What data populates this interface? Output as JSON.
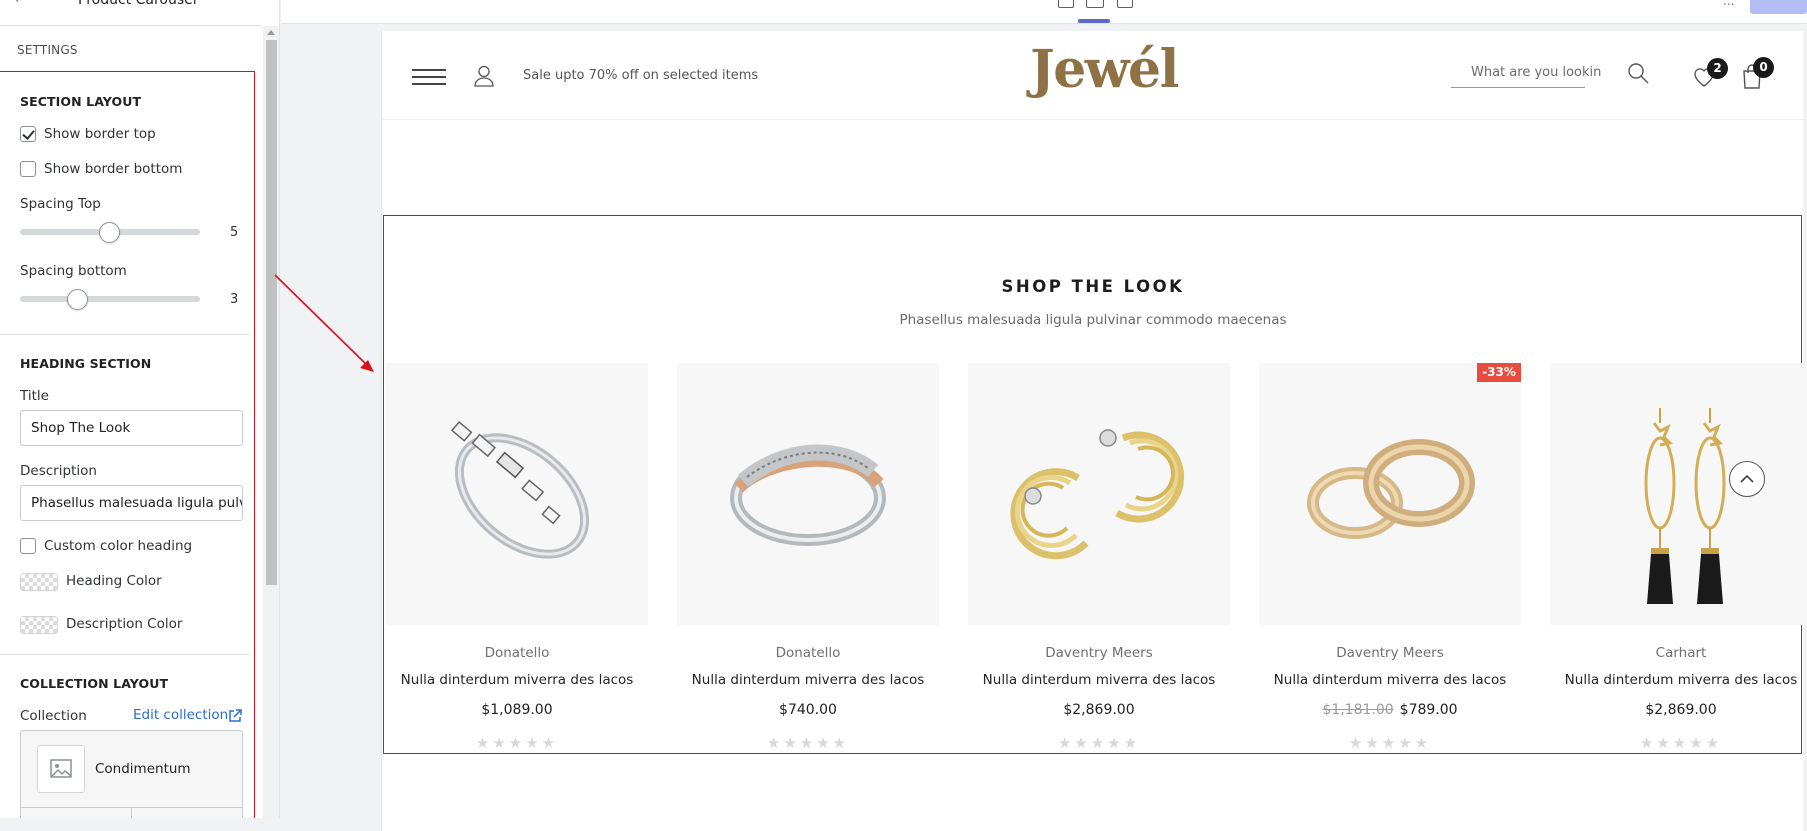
{
  "sidebar": {
    "back_icon": "arrow-left-icon",
    "page_title": "Product Carousel",
    "settings_label": "SETTINGS",
    "section_layout": {
      "title": "SECTION LAYOUT",
      "show_border_top": "Show border top",
      "show_border_bottom": "Show border bottom",
      "spacing_top_label": "Spacing Top",
      "spacing_top_value": "5",
      "spacing_bottom_label": "Spacing bottom",
      "spacing_bottom_value": "3"
    },
    "heading_section": {
      "title": "HEADING SECTION",
      "title_label": "Title",
      "title_value": "Shop The Look",
      "description_label": "Description",
      "description_value": "Phasellus malesuada ligula pulvir",
      "custom_color_label": "Custom color heading",
      "heading_color_label": "Heading Color",
      "description_color_label": "Description Color"
    },
    "collection_layout": {
      "title": "COLLECTION LAYOUT",
      "collection_label": "Collection",
      "edit_link": "Edit collection",
      "collection_name": "Condimentum"
    }
  },
  "topbar": {
    "right_text": "...",
    "accent": "#5c6ac4"
  },
  "store": {
    "promo": "Sale upto 70% off on selected items",
    "logo": "Jewél",
    "search_placeholder": "What are you lookin",
    "wishlist_count": "2",
    "cart_count": "0",
    "section": {
      "title": "SHOP THE LOOK",
      "subtitle": "Phasellus malesuada ligula pulvinar commodo maecenas"
    },
    "products": [
      {
        "vendor": "Donatello",
        "title": "Nulla dinterdum miverra des lacos",
        "price": "$1,089.00",
        "old_price": "",
        "badge": "",
        "stars": "★★★★★"
      },
      {
        "vendor": "Donatello",
        "title": "Nulla dinterdum miverra des lacos",
        "price": "$740.00",
        "old_price": "",
        "badge": "",
        "stars": "★★★★★"
      },
      {
        "vendor": "Daventry Meers",
        "title": "Nulla dinterdum miverra des lacos",
        "price": "$2,869.00",
        "old_price": "",
        "badge": "",
        "stars": "★★★★★"
      },
      {
        "vendor": "Daventry Meers",
        "title": "Nulla dinterdum miverra des lacos",
        "price": "$789.00",
        "old_price": "$1,181.00",
        "badge": "-33%",
        "stars": "★★★★★"
      },
      {
        "vendor": "Carhart",
        "title": "Nulla dinterdum miverra des lacos",
        "price": "$2,869.00",
        "old_price": "",
        "badge": "",
        "stars": "★★★★★"
      }
    ],
    "logo_color": "#8e7246",
    "highlight_color": "#d9101f"
  }
}
